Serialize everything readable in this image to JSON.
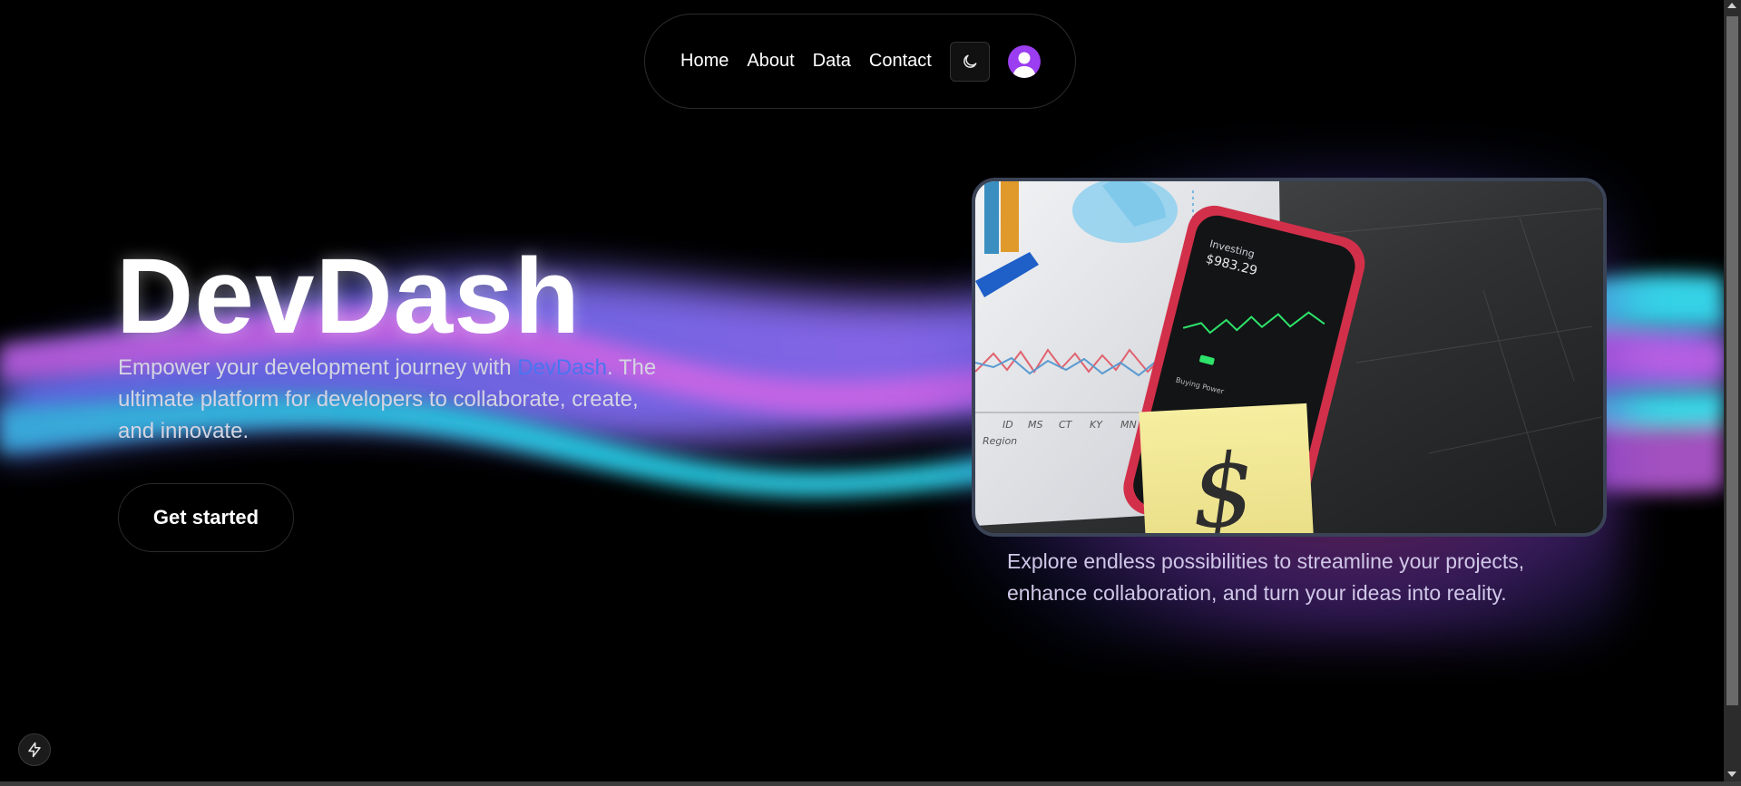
{
  "nav": {
    "links": [
      "Home",
      "About",
      "Data",
      "Contact"
    ]
  },
  "icons": {
    "theme_toggle": "moon-icon",
    "avatar": "user-avatar-icon",
    "badge": "lightning-bolt-icon"
  },
  "hero": {
    "title": "DevDash",
    "desc_before": "Empower your development journey with ",
    "desc_brand": "DevDash",
    "desc_after": ". The ultimate platform for developers to collaborate, create, and innovate.",
    "cta_label": "Get started"
  },
  "card": {
    "text": "Explore endless possibilities to streamline your projects, enhance collaboration, and turn your ideas into reality.",
    "photo": {
      "paper_labels": [
        "ID",
        "MS",
        "CT",
        "KY",
        "MN"
      ],
      "paper_axis_label": "Region",
      "phone_title": "Investing",
      "phone_value": "$983.29",
      "phone_footer": "Buying Power",
      "note_symbol": "$"
    }
  },
  "colors": {
    "background": "#000000",
    "brand_link": "#4a74f0",
    "avatar_bg": "#9b3df0",
    "wave_cyan": "#22c3dd",
    "wave_magenta": "#c560e0",
    "wave_violet": "#7a62f0"
  }
}
